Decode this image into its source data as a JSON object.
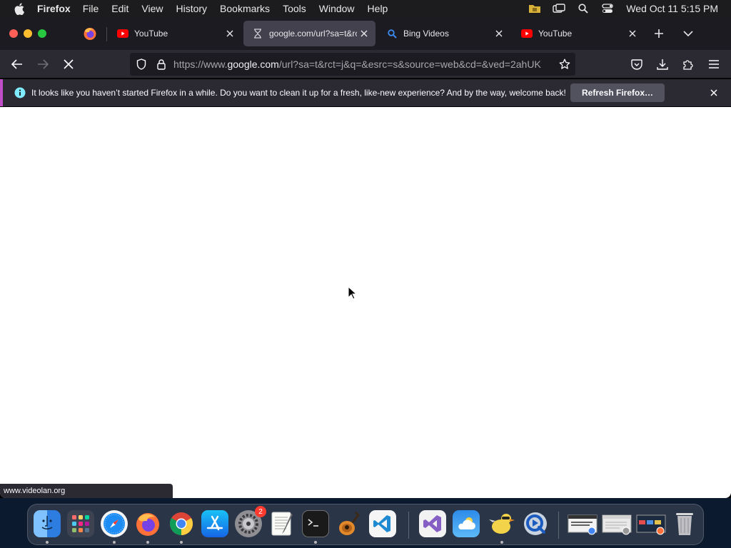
{
  "menubar": {
    "app_name": "Firefox",
    "items": [
      "File",
      "Edit",
      "View",
      "History",
      "Bookmarks",
      "Tools",
      "Window",
      "Help"
    ],
    "clock": "Wed Oct 11  5:15 PM"
  },
  "tabs": [
    {
      "title": "YouTube",
      "favicon": "youtube-icon",
      "active": false
    },
    {
      "title": "google.com/url?sa=t&rct=j&q=&esrc=s&source=web",
      "favicon": "hourglass-icon",
      "active": true
    },
    {
      "title": "Bing Videos",
      "favicon": "bing-search-icon",
      "active": false
    },
    {
      "title": "YouTube",
      "favicon": "youtube-icon",
      "active": false
    }
  ],
  "urlbar": {
    "prefix": "https://www.",
    "host": "google.com",
    "path": "/url?sa=t&rct=j&q=&esrc=s&source=web&cd=&ved=2ahUK"
  },
  "notification": {
    "message": "It looks like you haven’t started Firefox in a while. Do you want to clean it up for a fresh, like-new experience? And by the way, welcome back!",
    "button": "Refresh Firefox…"
  },
  "status_url": "www.videolan.org",
  "dock": {
    "apps": [
      "Finder",
      "Launchpad",
      "Safari",
      "Firefox",
      "Google Chrome",
      "App Store",
      "System Settings",
      "TextEdit",
      "Terminal",
      "GarageBand",
      "Visual Studio Code",
      "Visual Studio",
      "Weather",
      "Cyberduck",
      "QuickTime Player"
    ],
    "settings_badge": "2"
  },
  "colors": {
    "accent": "#c24dc9",
    "toolbar": "#2b2a33",
    "tabstrip": "#1c1b22"
  }
}
